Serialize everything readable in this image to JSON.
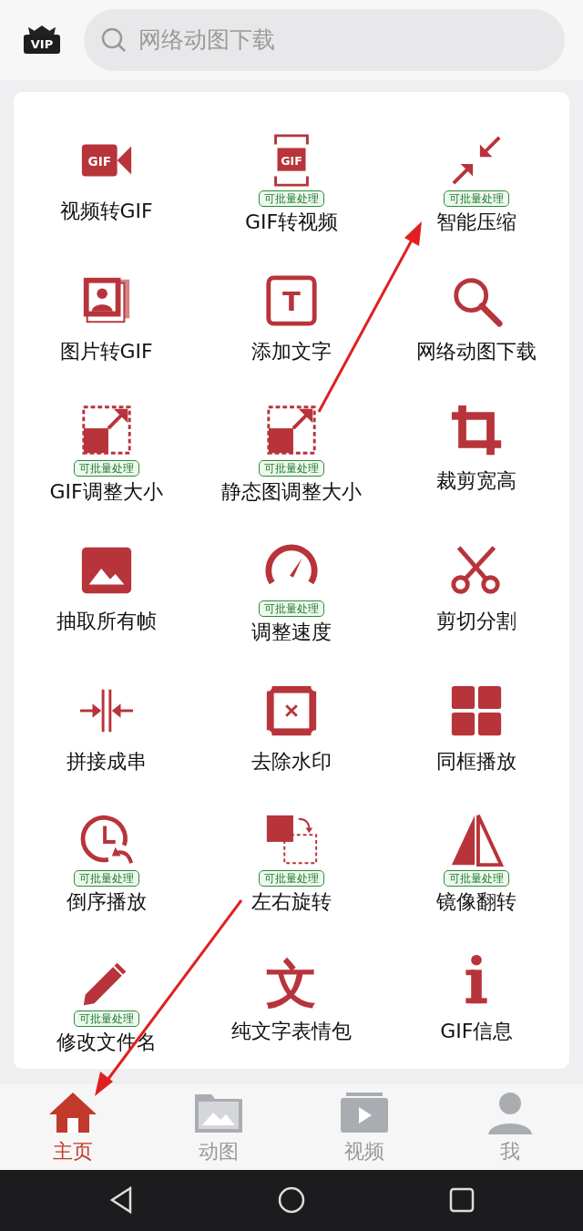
{
  "header": {
    "logo_text": "VIP",
    "search": {
      "placeholder": "网络动图下载"
    }
  },
  "tools": [
    {
      "label": "视频转GIF",
      "icon_text": "GIF"
    },
    {
      "label": "GIF转视频",
      "icon_text": "GIF",
      "badge": "可批量处理"
    },
    {
      "label": "智能压缩",
      "badge": "可批量处理"
    },
    {
      "label": "图片转GIF"
    },
    {
      "label": "添加文字",
      "icon_text": "T"
    },
    {
      "label": "网络动图下载"
    },
    {
      "label": "GIF调整大小",
      "badge": "可批量处理"
    },
    {
      "label": "静态图调整大小",
      "badge": "可批量处理"
    },
    {
      "label": "裁剪宽高"
    },
    {
      "label": "抽取所有帧"
    },
    {
      "label": "调整速度",
      "badge": "可批量处理"
    },
    {
      "label": "剪切分割"
    },
    {
      "label": "拼接成串"
    },
    {
      "label": "去除水印"
    },
    {
      "label": "同框播放"
    },
    {
      "label": "倒序播放",
      "badge": "可批量处理"
    },
    {
      "label": "左右旋转",
      "badge": "可批量处理"
    },
    {
      "label": "镜像翻转",
      "badge": "可批量处理"
    },
    {
      "label": "修改文件名",
      "badge": "可批量处理"
    },
    {
      "label": "纯文字表情包",
      "icon_text": "文"
    },
    {
      "label": "GIF信息"
    }
  ],
  "tabs": [
    {
      "label": "主页",
      "selected": true
    },
    {
      "label": "动图",
      "selected": false
    },
    {
      "label": "视频",
      "selected": false
    },
    {
      "label": "我",
      "selected": false
    }
  ]
}
